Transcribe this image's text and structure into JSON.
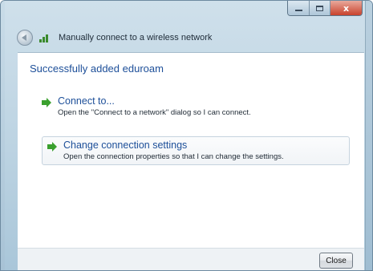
{
  "window": {
    "title": "Manually connect to a wireless network",
    "caption_buttons": {
      "minimize_icon": "minimize-icon",
      "maximize_icon": "maximize-icon",
      "close_glyph": "x"
    }
  },
  "nav": {
    "back_icon": "back-arrow-icon",
    "network_icon": "wireless-network-icon"
  },
  "main": {
    "heading": "Successfully added eduroam",
    "options": [
      {
        "label": "Connect to...",
        "description": "Open the \"Connect to a network\" dialog so I can connect.",
        "icon": "green-arrow-icon"
      },
      {
        "label": "Change connection settings",
        "description": "Open the connection properties so that I can change the settings.",
        "icon": "green-arrow-icon"
      }
    ]
  },
  "footer": {
    "close_label": "Close"
  },
  "colors": {
    "link": "#1d4f99",
    "accent_green": "#3aa02e",
    "frame": "#bcd3e2"
  }
}
